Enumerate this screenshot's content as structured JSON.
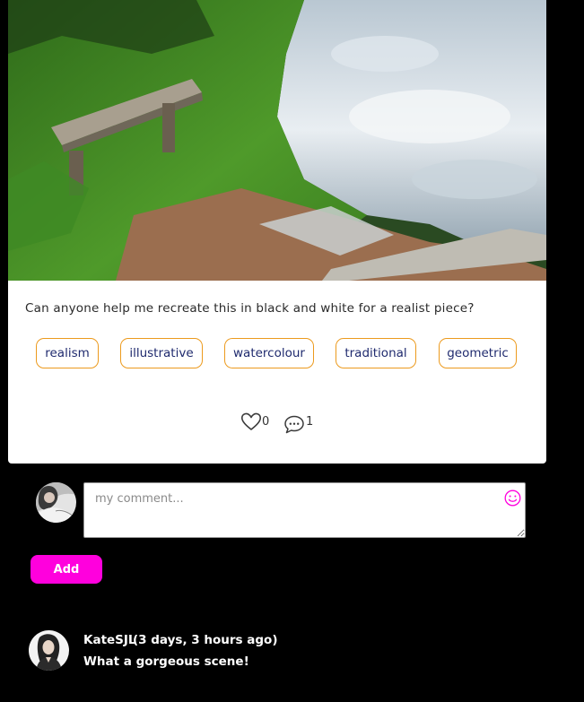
{
  "post": {
    "image_alt": "bench by a lake",
    "caption": "Can anyone help me recreate this in black and white for a realist piece?",
    "tags": [
      "realism",
      "illustrative",
      "watercolour",
      "traditional",
      "geometric"
    ],
    "likes": "0",
    "comments": "1"
  },
  "comment_form": {
    "placeholder": "my comment...",
    "add_label": "Add"
  },
  "comments": [
    {
      "author": "KateSJL",
      "time": "(3 days, 3 hours ago)",
      "text": "What a gorgeous scene!"
    }
  ],
  "colors": {
    "background": "#000000",
    "tag_border": "#ec9a1d",
    "tag_text": "#1f2a6e",
    "add_button": "#ff00dd"
  },
  "icons": {
    "like": "heart-outline-icon",
    "comment": "speech-bubble-icon",
    "emoji": "smiley-icon"
  }
}
